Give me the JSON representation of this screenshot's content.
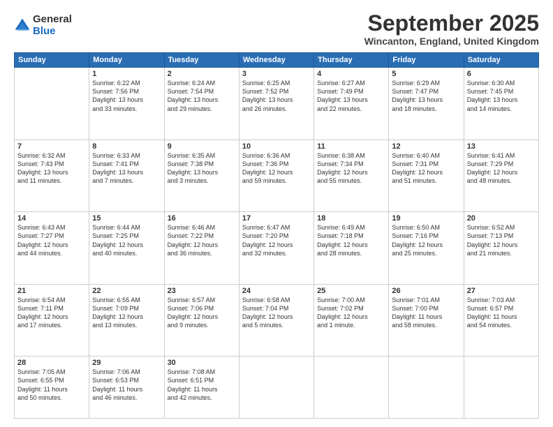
{
  "logo": {
    "general": "General",
    "blue": "Blue"
  },
  "header": {
    "month": "September 2025",
    "location": "Wincanton, England, United Kingdom"
  },
  "days_of_week": [
    "Sunday",
    "Monday",
    "Tuesday",
    "Wednesday",
    "Thursday",
    "Friday",
    "Saturday"
  ],
  "weeks": [
    [
      {
        "day": "",
        "info": ""
      },
      {
        "day": "1",
        "info": "Sunrise: 6:22 AM\nSunset: 7:56 PM\nDaylight: 13 hours\nand 33 minutes."
      },
      {
        "day": "2",
        "info": "Sunrise: 6:24 AM\nSunset: 7:54 PM\nDaylight: 13 hours\nand 29 minutes."
      },
      {
        "day": "3",
        "info": "Sunrise: 6:25 AM\nSunset: 7:52 PM\nDaylight: 13 hours\nand 26 minutes."
      },
      {
        "day": "4",
        "info": "Sunrise: 6:27 AM\nSunset: 7:49 PM\nDaylight: 13 hours\nand 22 minutes."
      },
      {
        "day": "5",
        "info": "Sunrise: 6:29 AM\nSunset: 7:47 PM\nDaylight: 13 hours\nand 18 minutes."
      },
      {
        "day": "6",
        "info": "Sunrise: 6:30 AM\nSunset: 7:45 PM\nDaylight: 13 hours\nand 14 minutes."
      }
    ],
    [
      {
        "day": "7",
        "info": "Sunrise: 6:32 AM\nSunset: 7:43 PM\nDaylight: 13 hours\nand 11 minutes."
      },
      {
        "day": "8",
        "info": "Sunrise: 6:33 AM\nSunset: 7:41 PM\nDaylight: 13 hours\nand 7 minutes."
      },
      {
        "day": "9",
        "info": "Sunrise: 6:35 AM\nSunset: 7:38 PM\nDaylight: 13 hours\nand 3 minutes."
      },
      {
        "day": "10",
        "info": "Sunrise: 6:36 AM\nSunset: 7:36 PM\nDaylight: 12 hours\nand 59 minutes."
      },
      {
        "day": "11",
        "info": "Sunrise: 6:38 AM\nSunset: 7:34 PM\nDaylight: 12 hours\nand 55 minutes."
      },
      {
        "day": "12",
        "info": "Sunrise: 6:40 AM\nSunset: 7:31 PM\nDaylight: 12 hours\nand 51 minutes."
      },
      {
        "day": "13",
        "info": "Sunrise: 6:41 AM\nSunset: 7:29 PM\nDaylight: 12 hours\nand 48 minutes."
      }
    ],
    [
      {
        "day": "14",
        "info": "Sunrise: 6:43 AM\nSunset: 7:27 PM\nDaylight: 12 hours\nand 44 minutes."
      },
      {
        "day": "15",
        "info": "Sunrise: 6:44 AM\nSunset: 7:25 PM\nDaylight: 12 hours\nand 40 minutes."
      },
      {
        "day": "16",
        "info": "Sunrise: 6:46 AM\nSunset: 7:22 PM\nDaylight: 12 hours\nand 36 minutes."
      },
      {
        "day": "17",
        "info": "Sunrise: 6:47 AM\nSunset: 7:20 PM\nDaylight: 12 hours\nand 32 minutes."
      },
      {
        "day": "18",
        "info": "Sunrise: 6:49 AM\nSunset: 7:18 PM\nDaylight: 12 hours\nand 28 minutes."
      },
      {
        "day": "19",
        "info": "Sunrise: 6:50 AM\nSunset: 7:16 PM\nDaylight: 12 hours\nand 25 minutes."
      },
      {
        "day": "20",
        "info": "Sunrise: 6:52 AM\nSunset: 7:13 PM\nDaylight: 12 hours\nand 21 minutes."
      }
    ],
    [
      {
        "day": "21",
        "info": "Sunrise: 6:54 AM\nSunset: 7:11 PM\nDaylight: 12 hours\nand 17 minutes."
      },
      {
        "day": "22",
        "info": "Sunrise: 6:55 AM\nSunset: 7:09 PM\nDaylight: 12 hours\nand 13 minutes."
      },
      {
        "day": "23",
        "info": "Sunrise: 6:57 AM\nSunset: 7:06 PM\nDaylight: 12 hours\nand 9 minutes."
      },
      {
        "day": "24",
        "info": "Sunrise: 6:58 AM\nSunset: 7:04 PM\nDaylight: 12 hours\nand 5 minutes."
      },
      {
        "day": "25",
        "info": "Sunrise: 7:00 AM\nSunset: 7:02 PM\nDaylight: 12 hours\nand 1 minute."
      },
      {
        "day": "26",
        "info": "Sunrise: 7:01 AM\nSunset: 7:00 PM\nDaylight: 11 hours\nand 58 minutes."
      },
      {
        "day": "27",
        "info": "Sunrise: 7:03 AM\nSunset: 6:57 PM\nDaylight: 11 hours\nand 54 minutes."
      }
    ],
    [
      {
        "day": "28",
        "info": "Sunrise: 7:05 AM\nSunset: 6:55 PM\nDaylight: 11 hours\nand 50 minutes."
      },
      {
        "day": "29",
        "info": "Sunrise: 7:06 AM\nSunset: 6:53 PM\nDaylight: 11 hours\nand 46 minutes."
      },
      {
        "day": "30",
        "info": "Sunrise: 7:08 AM\nSunset: 6:51 PM\nDaylight: 11 hours\nand 42 minutes."
      },
      {
        "day": "",
        "info": ""
      },
      {
        "day": "",
        "info": ""
      },
      {
        "day": "",
        "info": ""
      },
      {
        "day": "",
        "info": ""
      }
    ]
  ]
}
